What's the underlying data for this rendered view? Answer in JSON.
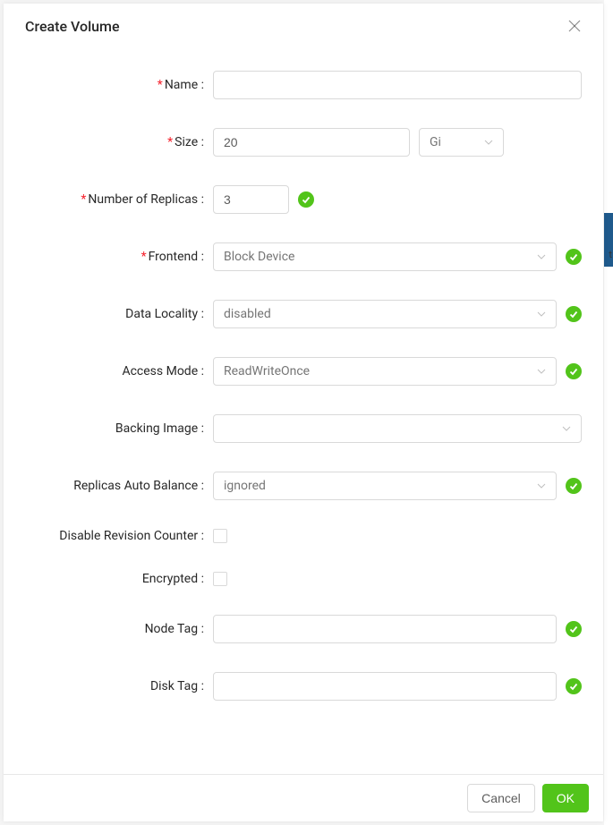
{
  "modal": {
    "title": "Create Volume",
    "fields": {
      "name": {
        "label": "Name",
        "value": "",
        "required": true
      },
      "size": {
        "label": "Size",
        "value": "20",
        "unit": "Gi",
        "required": true
      },
      "replicas": {
        "label": "Number of Replicas",
        "value": "3",
        "required": true,
        "valid": true
      },
      "frontend": {
        "label": "Frontend",
        "value": "Block Device",
        "required": true,
        "valid": true
      },
      "dataLocality": {
        "label": "Data Locality",
        "value": "disabled",
        "valid": true
      },
      "accessMode": {
        "label": "Access Mode",
        "value": "ReadWriteOnce",
        "valid": true
      },
      "backingImage": {
        "label": "Backing Image",
        "value": ""
      },
      "autoBalance": {
        "label": "Replicas Auto Balance",
        "value": "ignored",
        "valid": true
      },
      "disableRevCounter": {
        "label": "Disable Revision Counter",
        "checked": false
      },
      "encrypted": {
        "label": "Encrypted",
        "checked": false
      },
      "nodeTag": {
        "label": "Node Tag",
        "value": "",
        "valid": true
      },
      "diskTag": {
        "label": "Disk Tag",
        "value": "",
        "valid": true
      }
    },
    "footer": {
      "cancel": "Cancel",
      "ok": "OK"
    }
  }
}
